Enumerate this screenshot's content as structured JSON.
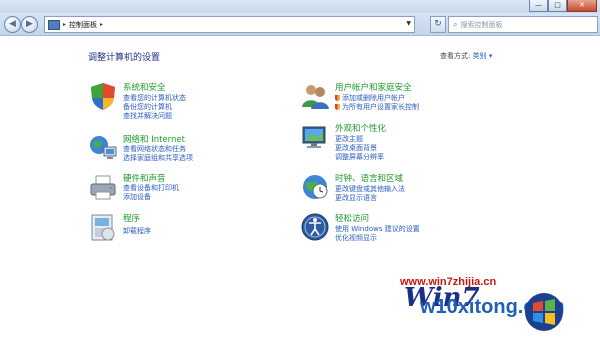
{
  "window": {
    "buttons": [
      "—",
      "□",
      "✕"
    ]
  },
  "nav": {
    "address_text": "控制面板",
    "search_placeholder": "搜索控制面板"
  },
  "main": {
    "heading": "调整计算机的设置",
    "view_by_label": "查看方式:",
    "view_by_value": "类别 ▾"
  },
  "categories": [
    {
      "title": "系统和安全",
      "icon": "shield-icon",
      "links": [
        "查看您的计算机状态",
        "备份您的计算机",
        "查找并解决问题"
      ]
    },
    {
      "title": "网络和 Internet",
      "icon": "network-icon",
      "links": [
        "查看网络状态和任务",
        "选择家庭组和共享选项"
      ]
    },
    {
      "title": "硬件和声音",
      "icon": "printer-icon",
      "links": [
        "查看设备和打印机",
        "添加设备"
      ]
    },
    {
      "title": "程序",
      "icon": "programs-icon",
      "links": [
        "卸载程序"
      ]
    },
    {
      "title": "用户帐户和家庭安全",
      "icon": "users-icon",
      "links": [
        "添加或删除用户帐户",
        "为所有用户设置家长控制"
      ]
    },
    {
      "title": "外观和个性化",
      "icon": "monitor-icon",
      "links": [
        "更改主题",
        "更改桌面背景",
        "调整屏幕分辨率"
      ]
    },
    {
      "title": "时钟、语言和区域",
      "icon": "clock-globe-icon",
      "links": [
        "更改键盘或其他输入法",
        "更改显示语言"
      ]
    },
    {
      "title": "轻松访问",
      "icon": "ease-of-access-icon",
      "links": [
        "使用 Windows 建议的设置",
        "优化视频显示"
      ]
    }
  ],
  "watermark": {
    "url": "www.win7zhijia.cn",
    "site": "w10xitong.com",
    "logo_text": "Win7"
  }
}
